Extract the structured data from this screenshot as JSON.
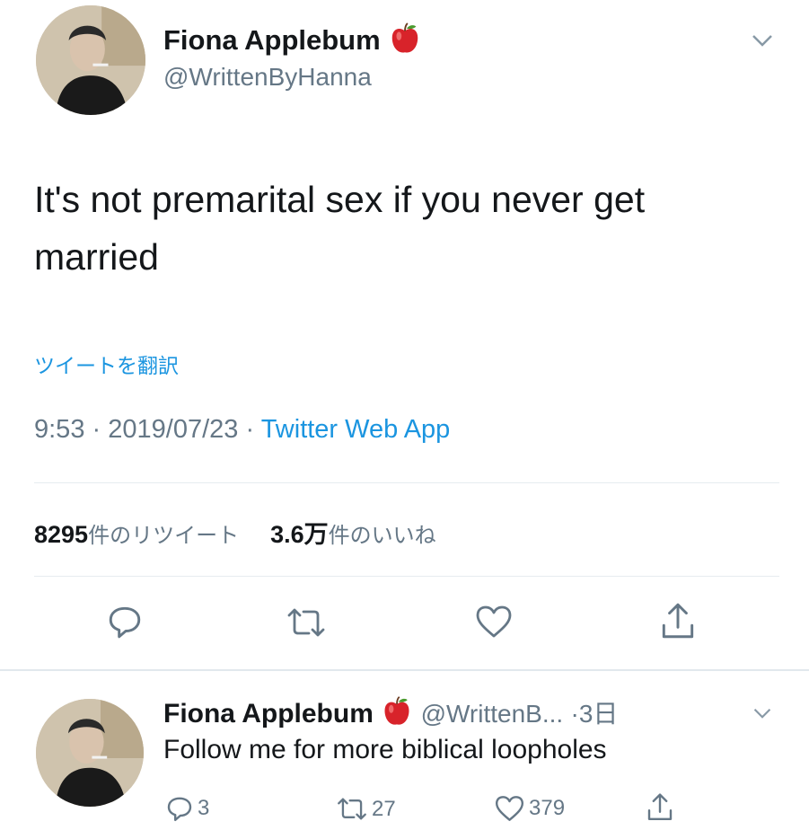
{
  "main_tweet": {
    "author_name": "Fiona Applebum",
    "author_handle": "@WrittenByHanna",
    "text_line1": "It's not premarital sex if you never get",
    "text_line2": "married",
    "translate_label": "ツイートを翻訳",
    "time": "9:53",
    "date": "2019/07/23",
    "separator": "·",
    "source": "Twitter Web App",
    "retweet_count": "8295",
    "retweet_label": "件のリツイート",
    "like_count": "3.6万",
    "like_label": "件のいいね"
  },
  "reply_tweet": {
    "author_name": "Fiona Applebum",
    "author_handle": "@WrittenB...",
    "separator": "·",
    "age": "3日",
    "text": "Follow me for more biblical loopholes",
    "reply_count": "3",
    "retweet_count": "27",
    "like_count": "379"
  },
  "icons": {
    "emoji": "red-apple-icon",
    "menu": "chevron-down-icon",
    "reply": "reply-icon",
    "retweet": "retweet-icon",
    "like": "heart-icon",
    "share": "share-icon"
  },
  "colors": {
    "link": "#1b95e0",
    "secondary": "#657786",
    "divider": "#e6ecf0",
    "apple": "#d8232a"
  }
}
